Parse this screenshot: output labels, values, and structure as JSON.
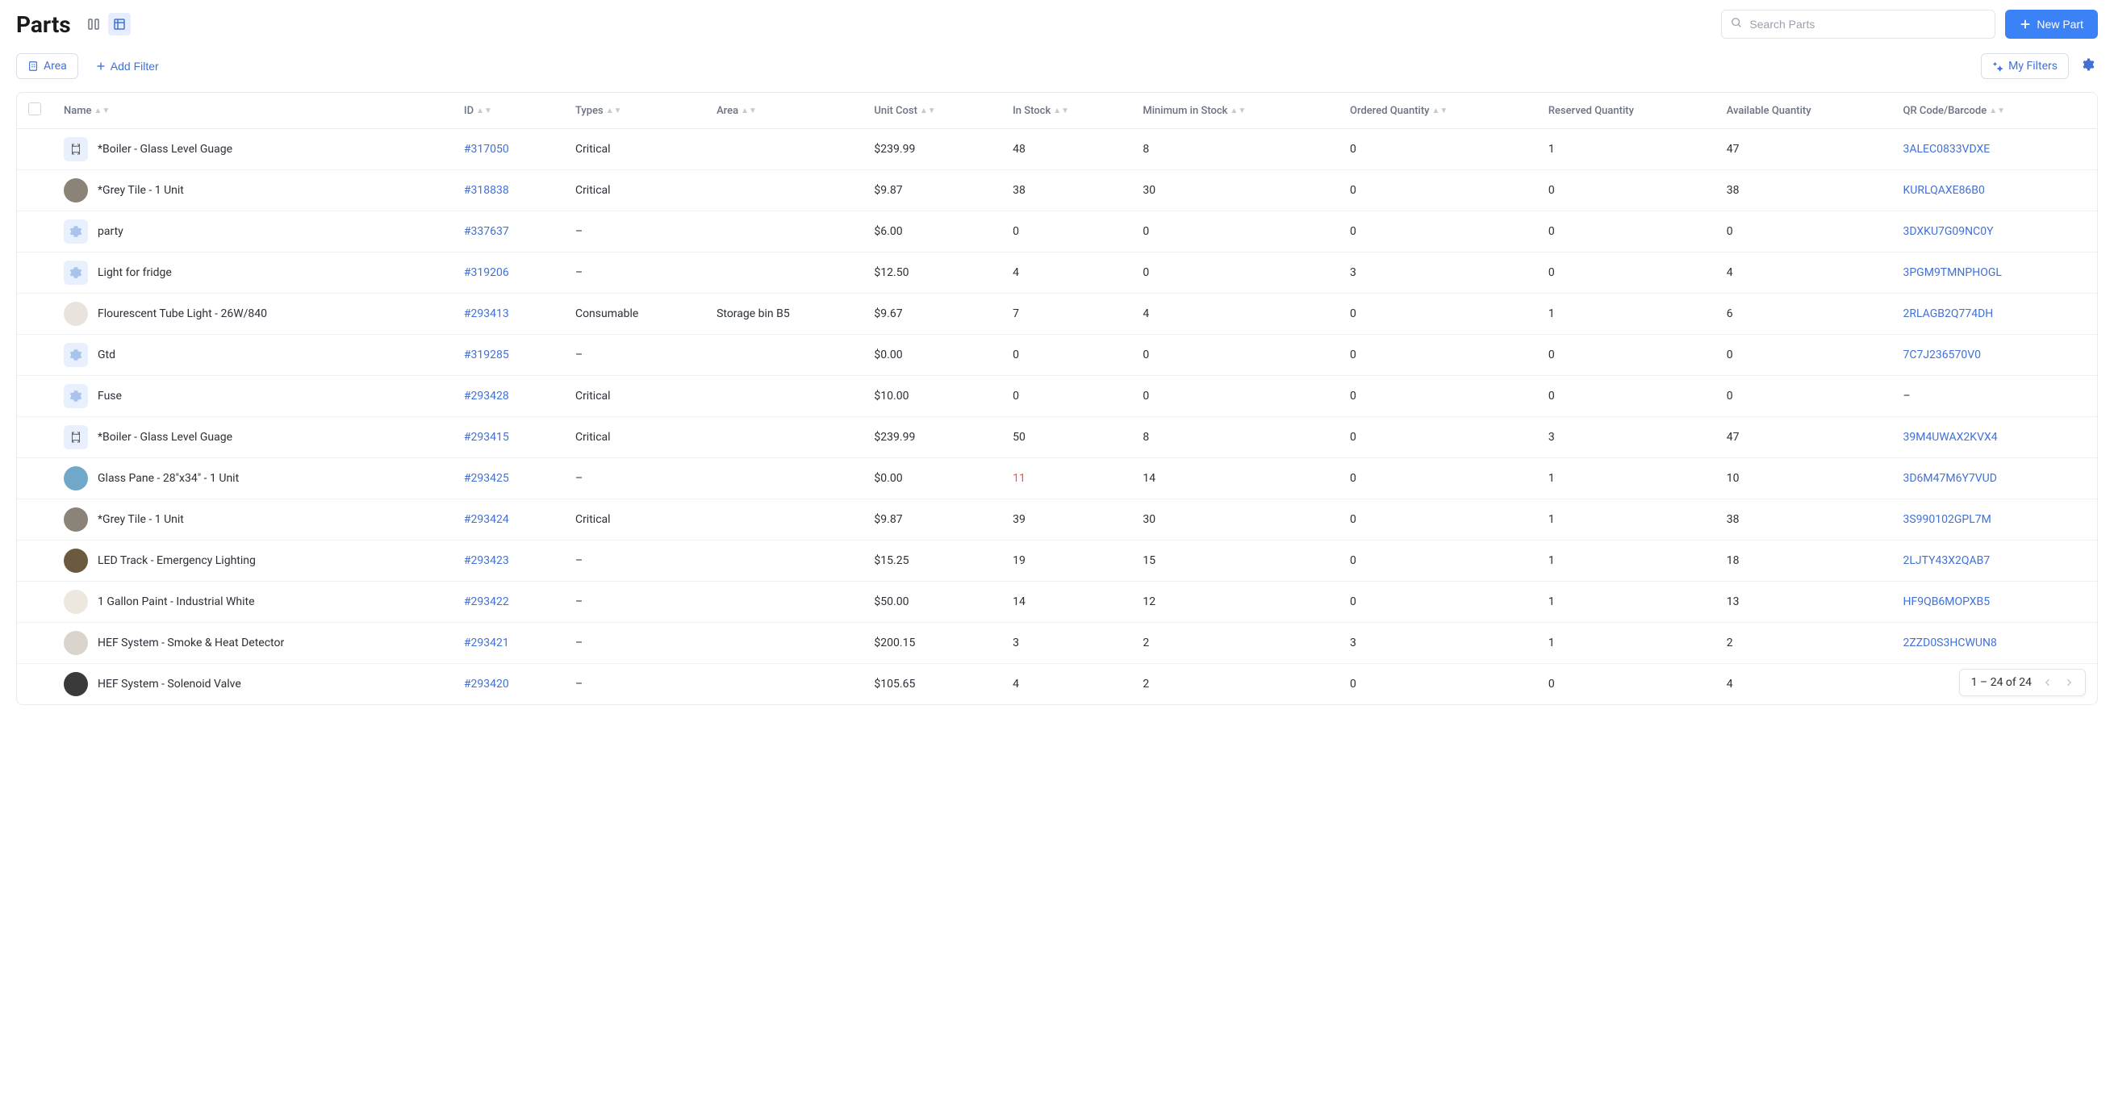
{
  "header": {
    "title": "Parts",
    "search_placeholder": "Search Parts",
    "new_part_label": "New Part"
  },
  "filters": {
    "area_label": "Area",
    "add_filter_label": "Add Filter",
    "my_filters_label": "My Filters"
  },
  "columns": {
    "name": "Name",
    "id": "ID",
    "types": "Types",
    "area": "Area",
    "unit_cost": "Unit Cost",
    "in_stock": "In Stock",
    "min_stock": "Minimum in Stock",
    "ordered_qty": "Ordered Quantity",
    "reserved_qty": "Reserved Quantity",
    "available_qty": "Available Quantity",
    "qr": "QR Code/Barcode"
  },
  "rows": [
    {
      "thumb": "caliper",
      "name": "*Boiler - Glass Level Guage",
      "id": "#317050",
      "types": "Critical",
      "area": "",
      "unit_cost": "$239.99",
      "in_stock": "48",
      "min_stock": "8",
      "ordered": "0",
      "reserved": "1",
      "available": "47",
      "qr": "3ALEC0833VDXE"
    },
    {
      "thumb": "tile",
      "name": "*Grey Tile - 1 Unit",
      "id": "#318838",
      "types": "Critical",
      "area": "",
      "unit_cost": "$9.87",
      "in_stock": "38",
      "min_stock": "30",
      "ordered": "0",
      "reserved": "0",
      "available": "38",
      "qr": "KURLQAXE86B0"
    },
    {
      "thumb": "gear",
      "name": "party",
      "id": "#337637",
      "types": "–",
      "area": "",
      "unit_cost": "$6.00",
      "in_stock": "0",
      "min_stock": "0",
      "ordered": "0",
      "reserved": "0",
      "available": "0",
      "qr": "3DXKU7G09NC0Y"
    },
    {
      "thumb": "gear",
      "name": "Light for fridge",
      "id": "#319206",
      "types": "–",
      "area": "",
      "unit_cost": "$12.50",
      "in_stock": "4",
      "min_stock": "0",
      "ordered": "3",
      "reserved": "0",
      "available": "4",
      "qr": "3PGM9TMNPHOGL"
    },
    {
      "thumb": "tube",
      "name": "Flourescent Tube Light - 26W/840",
      "id": "#293413",
      "types": "Consumable",
      "area": "Storage bin B5",
      "unit_cost": "$9.67",
      "in_stock": "7",
      "min_stock": "4",
      "ordered": "0",
      "reserved": "1",
      "available": "6",
      "qr": "2RLAGB2Q774DH"
    },
    {
      "thumb": "gear",
      "name": "Gtd",
      "id": "#319285",
      "types": "–",
      "area": "",
      "unit_cost": "$0.00",
      "in_stock": "0",
      "min_stock": "0",
      "ordered": "0",
      "reserved": "0",
      "available": "0",
      "qr": "7C7J236570V0"
    },
    {
      "thumb": "gear",
      "name": "Fuse",
      "id": "#293428",
      "types": "Critical",
      "area": "",
      "unit_cost": "$10.00",
      "in_stock": "0",
      "min_stock": "0",
      "ordered": "0",
      "reserved": "0",
      "available": "0",
      "qr": "–"
    },
    {
      "thumb": "caliper",
      "name": "*Boiler - Glass Level Guage",
      "id": "#293415",
      "types": "Critical",
      "area": "",
      "unit_cost": "$239.99",
      "in_stock": "50",
      "min_stock": "8",
      "ordered": "0",
      "reserved": "3",
      "available": "47",
      "qr": "39M4UWAX2KVX4"
    },
    {
      "thumb": "glass",
      "name": "Glass Pane - 28\"x34\" - 1 Unit",
      "id": "#293425",
      "types": "–",
      "area": "",
      "unit_cost": "$0.00",
      "in_stock": "11",
      "in_stock_low": true,
      "min_stock": "14",
      "ordered": "0",
      "reserved": "1",
      "available": "10",
      "qr": "3D6M47M6Y7VUD"
    },
    {
      "thumb": "tile",
      "name": "*Grey Tile - 1 Unit",
      "id": "#293424",
      "types": "Critical",
      "area": "",
      "unit_cost": "$9.87",
      "in_stock": "39",
      "min_stock": "30",
      "ordered": "0",
      "reserved": "1",
      "available": "38",
      "qr": "3S990102GPL7M"
    },
    {
      "thumb": "led",
      "name": "LED Track - Emergency Lighting",
      "id": "#293423",
      "types": "–",
      "area": "",
      "unit_cost": "$15.25",
      "in_stock": "19",
      "min_stock": "15",
      "ordered": "0",
      "reserved": "1",
      "available": "18",
      "qr": "2LJTY43X2QAB7"
    },
    {
      "thumb": "paint",
      "name": "1 Gallon Paint - Industrial White",
      "id": "#293422",
      "types": "–",
      "area": "",
      "unit_cost": "$50.00",
      "in_stock": "14",
      "min_stock": "12",
      "ordered": "0",
      "reserved": "1",
      "available": "13",
      "qr": "HF9QB6MOPXB5"
    },
    {
      "thumb": "detector",
      "name": "HEF System - Smoke & Heat Detector",
      "id": "#293421",
      "types": "–",
      "area": "",
      "unit_cost": "$200.15",
      "in_stock": "3",
      "min_stock": "2",
      "ordered": "3",
      "reserved": "1",
      "available": "2",
      "qr": "2ZZD0S3HCWUN8"
    },
    {
      "thumb": "valve",
      "name": "HEF System - Solenoid Valve",
      "id": "#293420",
      "types": "–",
      "area": "",
      "unit_cost": "$105.65",
      "in_stock": "4",
      "min_stock": "2",
      "ordered": "0",
      "reserved": "0",
      "available": "4",
      "qr": ""
    }
  ],
  "pagination": {
    "label": "1 – 24 of 24"
  }
}
